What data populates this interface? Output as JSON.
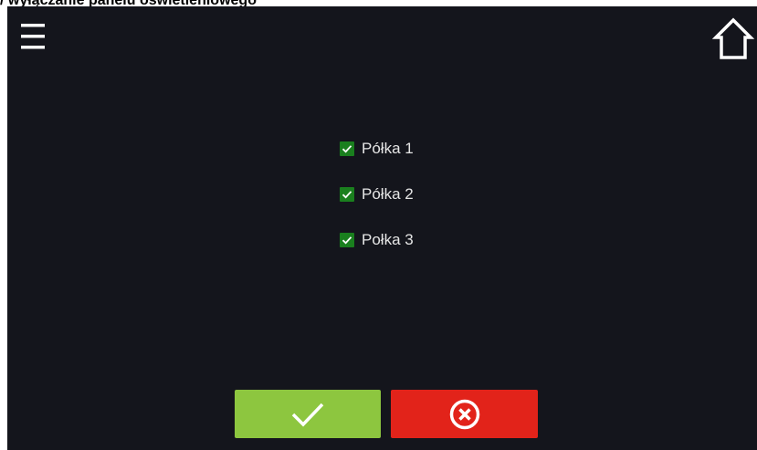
{
  "document": {
    "caption": "/ wyłączanie panelu oświetleniowego"
  },
  "screen": {
    "header": {
      "menu_icon": "hamburger-menu-icon",
      "home_icon": "home-icon"
    },
    "shelves": [
      {
        "label": "Półka 1",
        "checked": true
      },
      {
        "label": "Półka 2",
        "checked": true
      },
      {
        "label": "Połka 3",
        "checked": true
      }
    ],
    "footer": {
      "confirm_icon": "checkmark-icon",
      "cancel_icon": "cancel-circle-x-icon"
    },
    "colors": {
      "background": "#14151c",
      "checkbox": "#1a7f1e",
      "confirm": "#8dc63f",
      "cancel": "#e2231a",
      "text": "#e6e6e6"
    }
  }
}
